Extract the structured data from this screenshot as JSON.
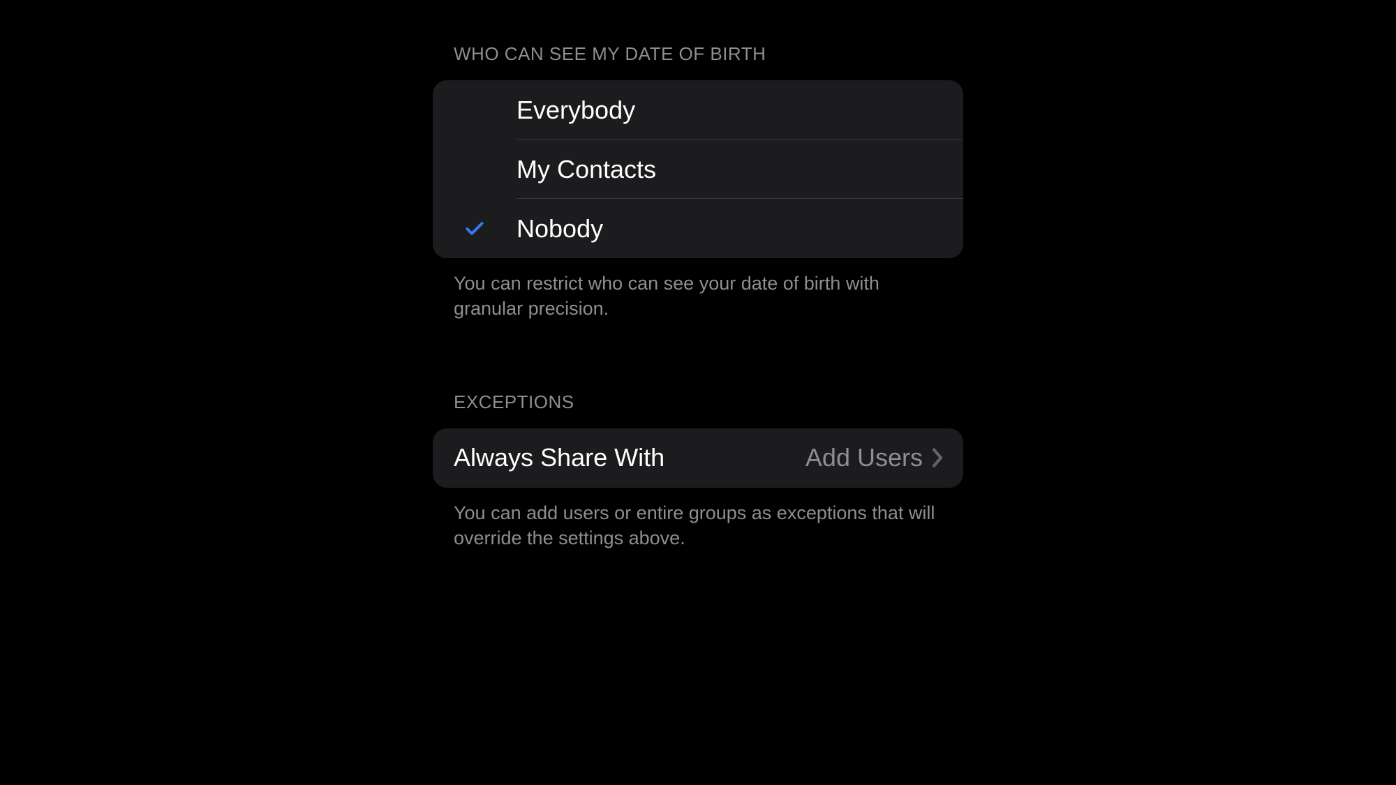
{
  "section1": {
    "header": "WHO CAN SEE MY DATE OF BIRTH",
    "options": [
      {
        "label": "Everybody",
        "selected": false
      },
      {
        "label": "My Contacts",
        "selected": false
      },
      {
        "label": "Nobody",
        "selected": true
      }
    ],
    "footer": "You can restrict who can see your date of birth with granular precision."
  },
  "section2": {
    "header": "EXCEPTIONS",
    "row": {
      "label": "Always Share With",
      "value": "Add Users"
    },
    "footer": "You can add users or entire groups as exceptions that will override the settings above."
  }
}
